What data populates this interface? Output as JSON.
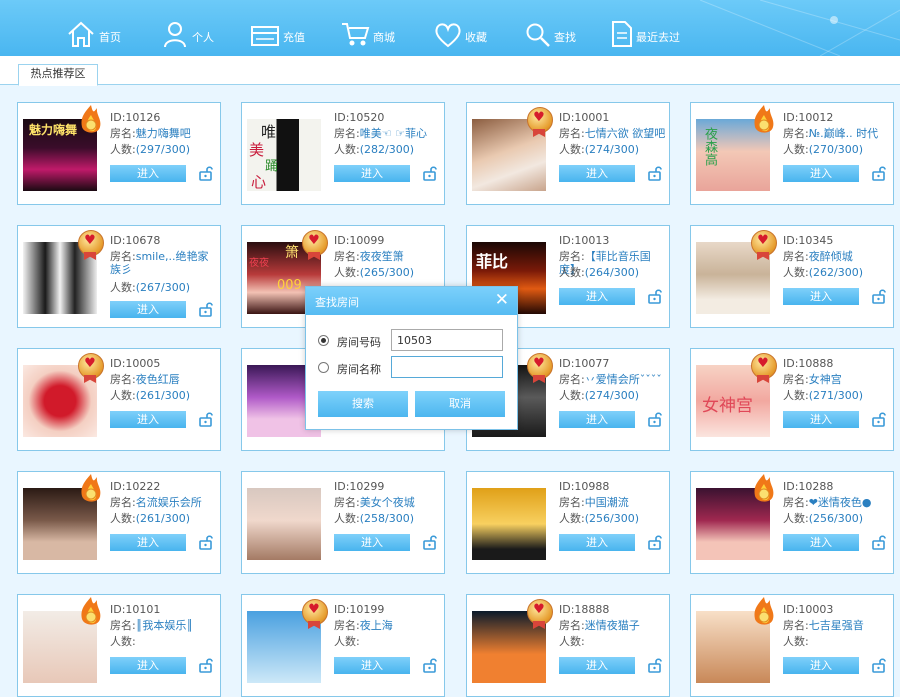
{
  "nav": [
    {
      "label": "首页",
      "icon": "home-icon"
    },
    {
      "label": "个人",
      "icon": "user-icon"
    },
    {
      "label": "充值",
      "icon": "recharge-icon"
    },
    {
      "label": "商城",
      "icon": "cart-icon"
    },
    {
      "label": "收藏",
      "icon": "heart-icon"
    },
    {
      "label": "查找",
      "icon": "search-icon"
    },
    {
      "label": "最近去过",
      "icon": "document-icon"
    }
  ],
  "tab": {
    "label": "热点推荐区"
  },
  "card_labels": {
    "name_prefix": "房名:",
    "count_prefix": "人数:",
    "enter": "进入"
  },
  "rooms": [
    {
      "id": "ID:10126",
      "name": "魅力嗨舞吧",
      "count": "(297/300)",
      "badge": "flame"
    },
    {
      "id": "ID:10520",
      "name": "唯美☜ ☞菲心",
      "count": "(282/300)",
      "badge": "none"
    },
    {
      "id": "ID:10001",
      "name": "七情六欲 欲望吧",
      "count": "(274/300)",
      "badge": "medal"
    },
    {
      "id": "ID:10012",
      "name": "№.巅峰.. 时代",
      "count": "(270/300)",
      "badge": "flame"
    },
    {
      "id": "ID:10678",
      "name": "smile,..绝艳家族彡",
      "count": "(267/300)",
      "badge": "medal"
    },
    {
      "id": "ID:10099",
      "name": "夜夜笙箫",
      "count": "(265/300)",
      "badge": "medal"
    },
    {
      "id": "ID:10013",
      "name": "【菲比音乐国度】",
      "count": "(264/300)",
      "badge": "none"
    },
    {
      "id": "ID:10345",
      "name": "夜醉倾城",
      "count": "(262/300)",
      "badge": "medal"
    },
    {
      "id": "ID:10005",
      "name": "夜色红唇",
      "count": "(261/300)",
      "badge": "medal"
    },
    {
      "id": "",
      "name": "",
      "count": "",
      "badge": "none"
    },
    {
      "id": "ID:10077",
      "name": "丷爱情会所ˇˇˇˇ",
      "count": "(274/300)",
      "badge": "medal"
    },
    {
      "id": "ID:10888",
      "name": "女神宫",
      "count": "(271/300)",
      "badge": "medal"
    },
    {
      "id": "ID:10222",
      "name": "名流娱乐会所",
      "count": "(261/300)",
      "badge": "flame"
    },
    {
      "id": "ID:10299",
      "name": "美女个夜城",
      "count": "(258/300)",
      "badge": "none"
    },
    {
      "id": "ID:10988",
      "name": "中国潮流",
      "count": "(256/300)",
      "badge": "none"
    },
    {
      "id": "ID:10288",
      "name": "❤迷情夜色●",
      "count": "(256/300)",
      "badge": "flame"
    },
    {
      "id": "ID:10101",
      "name": "║我本娱乐║",
      "count": "",
      "badge": "flame"
    },
    {
      "id": "ID:10199",
      "name": "夜上海",
      "count": "",
      "badge": "medal"
    },
    {
      "id": "ID:18888",
      "name": "迷情夜猫子",
      "count": "",
      "badge": "medal"
    },
    {
      "id": "ID:10003",
      "name": "七吉星强音",
      "count": "",
      "badge": "flame"
    }
  ],
  "thumb_texts": {
    "t0": "魅力嗨舞",
    "t1": [
      "唯",
      "美",
      "心",
      "踊"
    ],
    "t5": [
      "箫",
      "夜夜",
      "009"
    ],
    "t6": "菲比",
    "t11": "女神宫",
    "t3": "夜森高"
  },
  "dialog": {
    "title": "查找房间",
    "close": "✕",
    "opt1": "房间号码",
    "opt2": "房间名称",
    "room_number": "10503",
    "room_name": "",
    "search": "搜索",
    "cancel": "取消"
  },
  "colors": {
    "topbar": "#49b6f0",
    "accent": "#2a7fc0",
    "button": "#48b4ee",
    "border": "#86c8ea"
  }
}
